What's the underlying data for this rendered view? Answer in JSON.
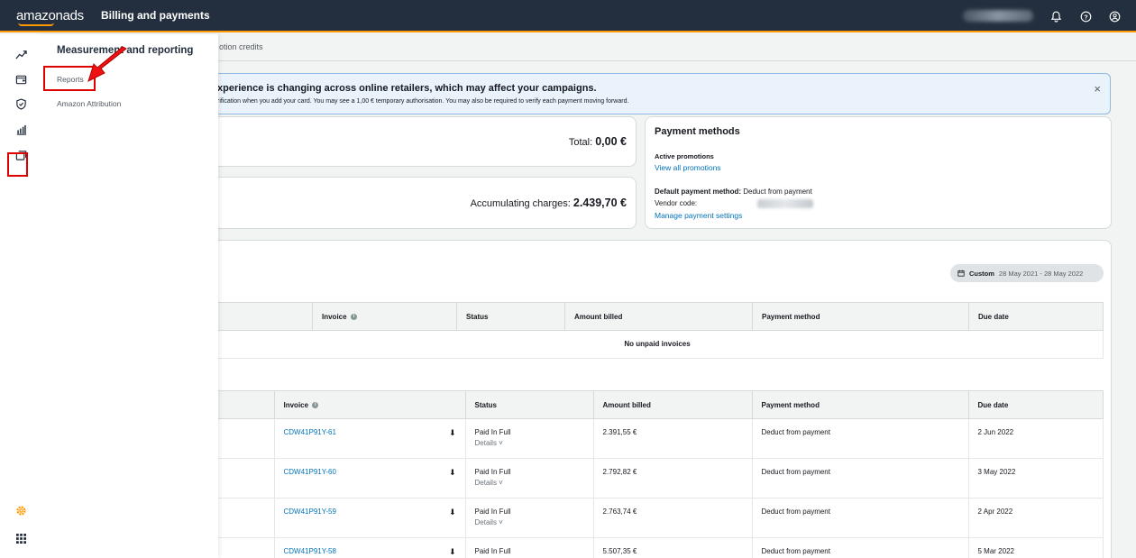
{
  "header": {
    "logo": "amazonads",
    "app_title": "Billing and payments",
    "icons": [
      "bell-icon",
      "help-icon",
      "user-icon"
    ]
  },
  "subbar": {
    "tab_fragment": "otion credits"
  },
  "alert": {
    "title": "xperience is changing across online retailers, which may affect your campaigns.",
    "body": "rification when you add your card. You may see a 1,00 € temporary authorisation. You may also be required to verify each payment moving forward.",
    "close": "×"
  },
  "summary": {
    "total_label": "Total:",
    "total_value": "0,00 €",
    "accumulating_label": "Accumulating charges:",
    "accumulating_value": "2.439,70 €"
  },
  "payment_methods": {
    "title": "Payment methods",
    "active_promotions": "Active promotions",
    "view_all": "View all promotions",
    "default_label": "Default payment method:",
    "default_value": "Deduct from payment",
    "vendor_label": "Vendor code:",
    "manage_link": "Manage payment settings"
  },
  "date_range": {
    "label": "Custom",
    "range": "28 May 2021 - 28 May 2022"
  },
  "unpaid_table": {
    "headers": [
      "Invoice",
      "Status",
      "Amount billed",
      "Payment method",
      "Due date"
    ],
    "empty_message": "No unpaid invoices"
  },
  "paid_table": {
    "headers": [
      "Invoice",
      "Status",
      "Amount billed",
      "Payment method",
      "Due date"
    ],
    "rows": [
      {
        "invoice": "CDW41P91Y-61",
        "status": "Paid In Full",
        "details": "Details ˅",
        "amount": "2.391,55 €",
        "method": "Deduct from payment",
        "due": "2 Jun 2022"
      },
      {
        "invoice": "CDW41P91Y-60",
        "status": "Paid In Full",
        "details": "Details ˅",
        "amount": "2.792,82 €",
        "method": "Deduct from payment",
        "due": "3 May 2022"
      },
      {
        "invoice": "CDW41P91Y-59",
        "status": "Paid In Full",
        "details": "Details ˅",
        "amount": "2.763,74 €",
        "method": "Deduct from payment",
        "due": "2 Apr 2022"
      },
      {
        "invoice": "CDW41P91Y-58",
        "status": "Paid In Full",
        "details": "",
        "amount": "5.507,35 €",
        "method": "Deduct from payment",
        "due": "5 Mar 2022"
      }
    ]
  },
  "flyout": {
    "title": "Measurement and reporting",
    "items": [
      "Reports",
      "Amazon Attribution"
    ]
  },
  "rail": {
    "icons": [
      "trend-icon",
      "wallet-icon",
      "shield-icon",
      "bar-chart-icon",
      "media-icon",
      "settings-icon",
      "apps-grid-icon"
    ]
  },
  "colors": {
    "header": "#232f3e",
    "accent": "#ff9900",
    "link": "#0073bb",
    "highlight": "#e00000"
  }
}
